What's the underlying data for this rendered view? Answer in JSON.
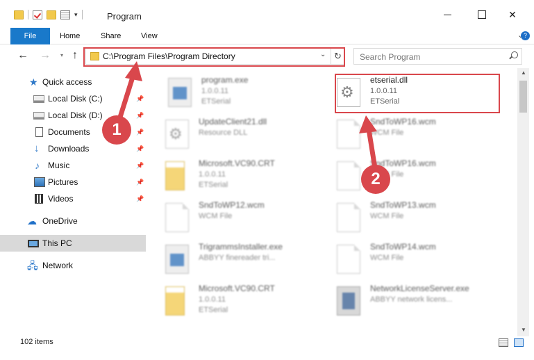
{
  "window": {
    "title": "Program",
    "close_glyph": "✕"
  },
  "ribbon": {
    "tabs": [
      "File",
      "Home",
      "Share",
      "View"
    ]
  },
  "navigation": {
    "address": "C:\\Program Files\\Program Directory",
    "search_placeholder": "Search Program"
  },
  "sidebar": {
    "items": [
      {
        "label": "Quick access",
        "icon": "star-icon",
        "pinned": false
      },
      {
        "label": "Local Disk (C:)",
        "icon": "disk-icon",
        "pinned": true
      },
      {
        "label": "Local Disk (D:)",
        "icon": "disk-icon",
        "pinned": true
      },
      {
        "label": "Documents",
        "icon": "document-icon",
        "pinned": true
      },
      {
        "label": "Downloads",
        "icon": "download-icon",
        "pinned": true
      },
      {
        "label": "Music",
        "icon": "music-icon",
        "pinned": true
      },
      {
        "label": "Pictures",
        "icon": "pictures-icon",
        "pinned": true
      },
      {
        "label": "Videos",
        "icon": "videos-icon",
        "pinned": true
      },
      {
        "label": "OneDrive",
        "icon": "cloud-icon",
        "pinned": false
      },
      {
        "label": "This PC",
        "icon": "computer-icon",
        "pinned": false,
        "selected": true
      },
      {
        "label": "Network",
        "icon": "network-icon",
        "pinned": false
      }
    ]
  },
  "files": [
    {
      "name": "program.exe",
      "line2": "1.0.0.11",
      "line3": "ETSerial",
      "icon": "exe-icon",
      "blurred": true
    },
    {
      "name": "etserial.dll",
      "line2": "1.0.0.11",
      "line3": "ETSerial",
      "icon": "gear-file-icon",
      "blurred": false
    },
    {
      "name": "UpdateClient21.dll",
      "line2": "Resource DLL",
      "line3": "",
      "icon": "gear-file-icon",
      "blurred": true
    },
    {
      "name": "SndToWP16.wcm",
      "line2": "WCM File",
      "line3": "",
      "icon": "document-icon",
      "blurred": true
    },
    {
      "name": "Microsoft.VC90.CRT",
      "line2": "1.0.0.11",
      "line3": "ETSerial",
      "icon": "folder-icon",
      "blurred": true
    },
    {
      "name": "SndToWP16.wcm",
      "line2": "WCM File",
      "line3": "",
      "icon": "document-icon",
      "blurred": true
    },
    {
      "name": "SndToWP12.wcm",
      "line2": "WCM File",
      "line3": "",
      "icon": "document-icon",
      "blurred": true
    },
    {
      "name": "SndToWP13.wcm",
      "line2": "WCM File",
      "line3": "",
      "icon": "document-icon",
      "blurred": true
    },
    {
      "name": "TrigrammsInstaller.exe",
      "line2": "ABBYY finereader tri...",
      "line3": "",
      "icon": "app-icon",
      "blurred": true
    },
    {
      "name": "SndToWP14.wcm",
      "line2": "WCM File",
      "line3": "",
      "icon": "document-icon",
      "blurred": true
    },
    {
      "name": "Microsoft.VC90.CRT",
      "line2": "1.0.0.11",
      "line3": "ETSerial",
      "icon": "folder-icon",
      "blurred": true
    },
    {
      "name": "NetworkLicenseServer.exe",
      "line2": "ABBYY network licens...",
      "line3": "",
      "icon": "app-icon",
      "blurred": true
    }
  ],
  "annotations": {
    "badge_1": "1",
    "badge_2": "2",
    "color": "#d9474c"
  },
  "status": {
    "item_count": "102 items"
  }
}
